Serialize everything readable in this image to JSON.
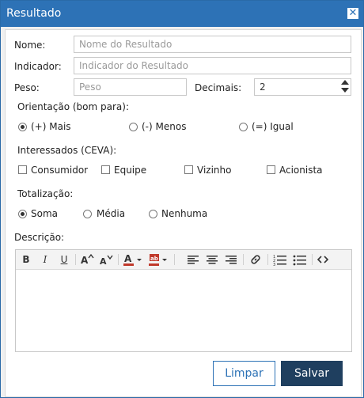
{
  "dialog": {
    "title": "Resultado",
    "close_glyph": "✕"
  },
  "form": {
    "nome": {
      "label": "Nome:",
      "value": "",
      "placeholder": "Nome do Resultado"
    },
    "indicador": {
      "label": "Indicador:",
      "value": "",
      "placeholder": "Indicador do Resultado"
    },
    "peso": {
      "label": "Peso:",
      "value": "",
      "placeholder": "Peso"
    },
    "decimais": {
      "label": "Decimais:",
      "value": "2"
    },
    "orientacao": {
      "label": "Orientação (bom para):",
      "options": [
        {
          "label": "(+) Mais",
          "selected": true
        },
        {
          "label": "(-) Menos",
          "selected": false
        },
        {
          "label": "(=) Igual",
          "selected": false
        }
      ]
    },
    "interessados": {
      "label": "Interessados (CEVA):",
      "options": [
        {
          "label": "Consumidor",
          "checked": false
        },
        {
          "label": "Equipe",
          "checked": false
        },
        {
          "label": "Vizinho",
          "checked": false
        },
        {
          "label": "Acionista",
          "checked": false
        }
      ]
    },
    "totalizacao": {
      "label": "Totalização:",
      "options": [
        {
          "label": "Soma",
          "selected": true
        },
        {
          "label": "Média",
          "selected": false
        },
        {
          "label": "Nenhuma",
          "selected": false
        }
      ]
    },
    "descricao": {
      "label": "Descrição:",
      "value": ""
    }
  },
  "editor_toolbar": {
    "icons": [
      "bold-icon",
      "italic-icon",
      "underline-icon",
      "font-size-increase-icon",
      "font-size-decrease-icon",
      "font-color-icon",
      "highlight-icon",
      "align-left-icon",
      "align-center-icon",
      "align-right-icon",
      "link-icon",
      "ordered-list-icon",
      "unordered-list-icon",
      "source-code-icon"
    ],
    "bold": "B",
    "italic": "I",
    "underline": "U"
  },
  "buttons": {
    "limpar": "Limpar",
    "salvar": "Salvar"
  },
  "colors": {
    "titlebar": "#2d72b6",
    "primary_button": "#1f3f5f",
    "accent": "#2d72b6"
  }
}
